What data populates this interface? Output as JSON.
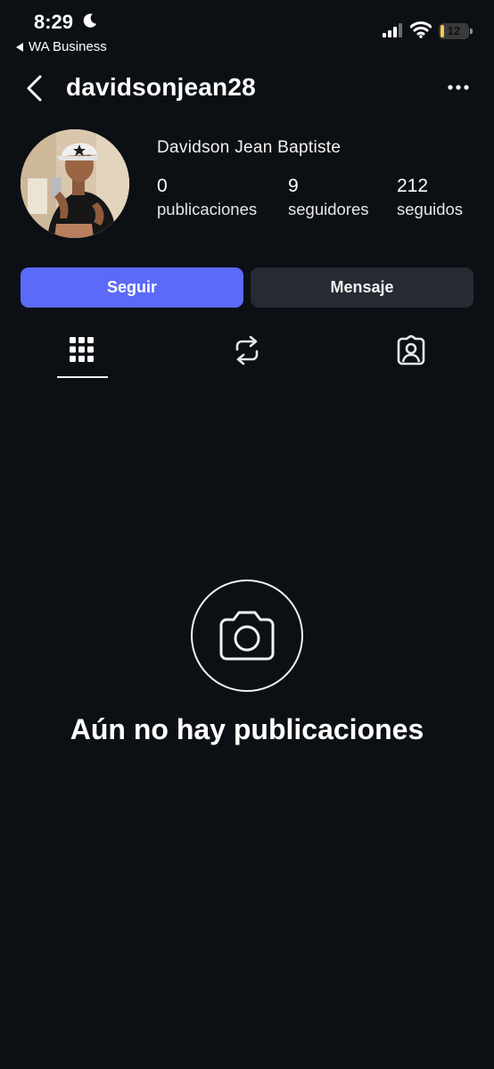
{
  "status_bar": {
    "time": "8:29",
    "back_app": "WA Business",
    "battery": "12",
    "battery_level": 0.12
  },
  "header": {
    "username": "davidsonjean28"
  },
  "profile": {
    "full_name": "Davidson Jean Baptiste",
    "stats": [
      {
        "value": "0",
        "label": "publicaciones"
      },
      {
        "value": "9",
        "label": "seguidores"
      },
      {
        "value": "212",
        "label": "seguidos"
      }
    ]
  },
  "actions": {
    "follow": "Seguir",
    "message": "Mensaje"
  },
  "tabs": [
    {
      "icon": "grid-icon",
      "active": true
    },
    {
      "icon": "reposts-icon",
      "active": false
    },
    {
      "icon": "tagged-icon",
      "active": false
    }
  ],
  "empty_state": {
    "icon": "camera-icon",
    "text": "Aún no hay publicaciones"
  },
  "colors": {
    "background": "#0c1014",
    "follow_button": "#5b6af8",
    "message_button": "#262a33",
    "battery_fill": "#f2c94c"
  }
}
